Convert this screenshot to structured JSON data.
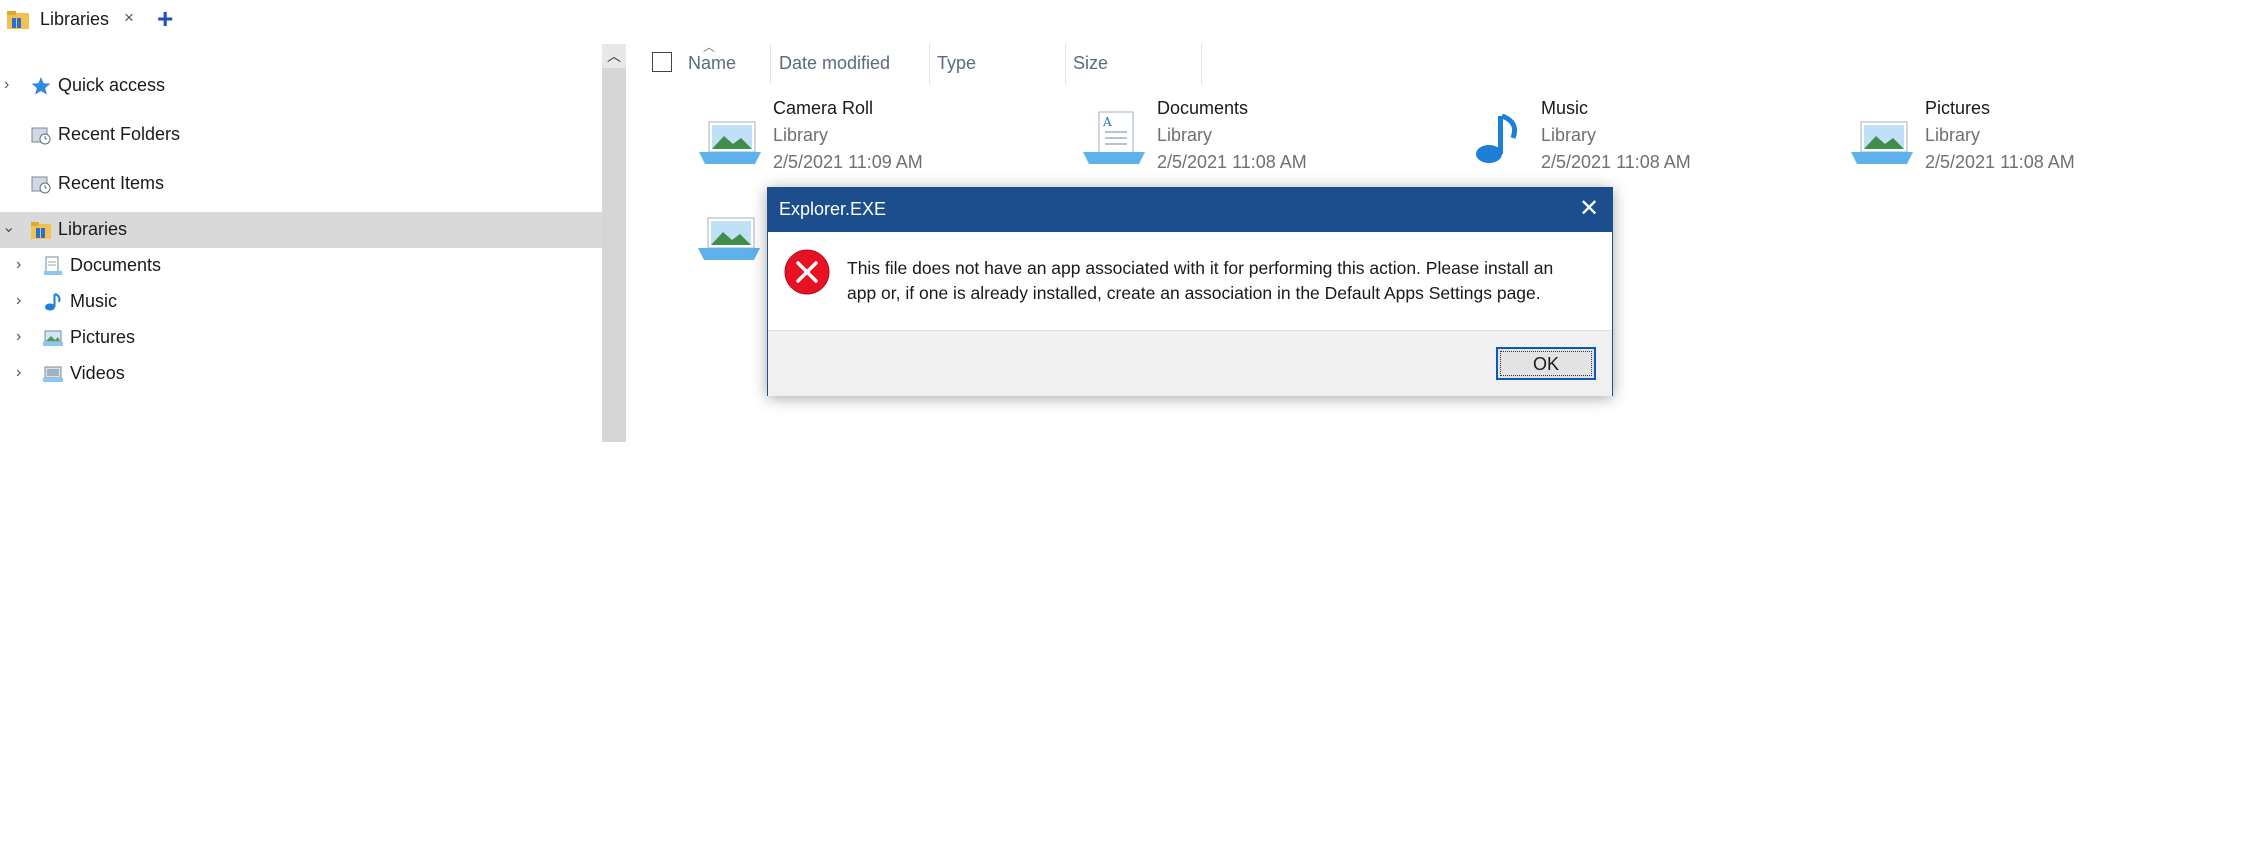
{
  "tab": {
    "label": "Libraries",
    "close_glyph": "×",
    "new_tab_glyph": "+",
    "icon": "libraries-folder-icon"
  },
  "nav": {
    "items": [
      {
        "label": "Quick access",
        "icon": "star-icon",
        "expander": "›"
      },
      {
        "label": "Recent Folders",
        "icon": "recent-folders-icon"
      },
      {
        "label": "Recent Items",
        "icon": "recent-items-icon"
      },
      {
        "label": "Libraries",
        "icon": "libraries-folder-icon",
        "expander": "⌄",
        "selected": true
      },
      {
        "label": "Documents",
        "icon": "documents-library-icon",
        "expander": "›"
      },
      {
        "label": "Music",
        "icon": "music-library-icon",
        "expander": "›"
      },
      {
        "label": "Pictures",
        "icon": "pictures-library-icon",
        "expander": "›"
      },
      {
        "label": "Videos",
        "icon": "videos-library-icon",
        "expander": "›"
      }
    ]
  },
  "columns": {
    "name": "Name",
    "date_modified": "Date modified",
    "type": "Type",
    "size": "Size"
  },
  "tiles": [
    {
      "name": "Camera Roll",
      "type": "Library",
      "date": "2/5/2021 11:09 AM",
      "icon": "camera-roll-library-icon"
    },
    {
      "name": "Documents",
      "type": "Library",
      "date": "2/5/2021 11:08 AM",
      "icon": "documents-library-icon"
    },
    {
      "name": "Music",
      "type": "Library",
      "date": "2/5/2021 11:08 AM",
      "icon": "music-library-icon"
    },
    {
      "name": "Pictures",
      "type": "Library",
      "date": "2/5/2021 11:08 AM",
      "icon": "pictures-library-icon"
    }
  ],
  "dialog": {
    "title": "Explorer.EXE",
    "close_glyph": "✕",
    "message": "This file does not have an app associated with it for performing this action. Please install an app or, if one is already installed, create an association in the Default Apps Settings page.",
    "ok_label": "OK",
    "icon": "error-icon"
  },
  "colors": {
    "dialog_title_bg": "#1c4d8c",
    "error_red": "#e81123",
    "selected_bg": "#d9d9d9",
    "accent_blue": "#1f4fbf"
  }
}
